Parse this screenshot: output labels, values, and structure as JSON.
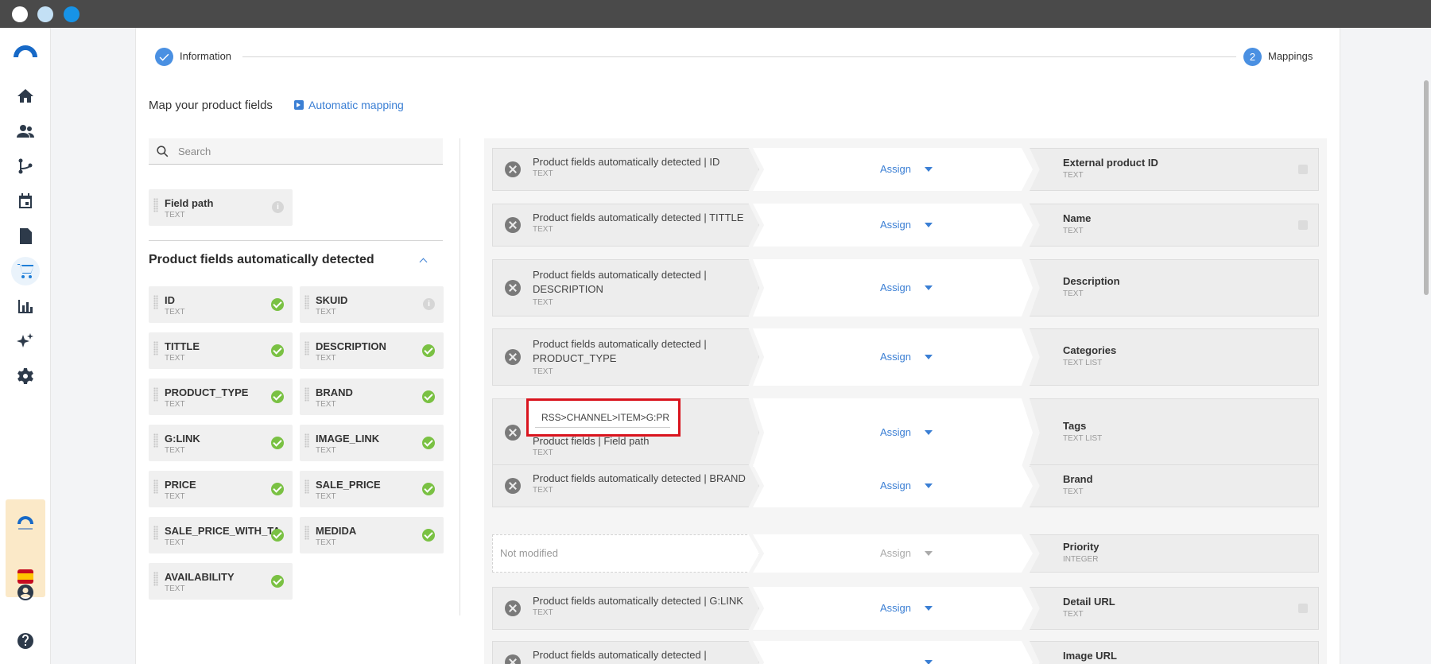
{
  "stepper": {
    "step1_label": "Information",
    "step2_number": "2",
    "step2_label": "Mappings"
  },
  "header": {
    "title": "Map your product fields",
    "auto_mapping": "Automatic mapping"
  },
  "search": {
    "placeholder": "Search"
  },
  "field_path_chip": {
    "name": "Field path",
    "type": "TEXT"
  },
  "section": {
    "title": "Product fields automatically detected"
  },
  "detected_fields": [
    {
      "name": "ID",
      "type": "TEXT",
      "status": "ok"
    },
    {
      "name": "SKUID",
      "type": "TEXT",
      "status": "info"
    },
    {
      "name": "TITTLE",
      "type": "TEXT",
      "status": "ok"
    },
    {
      "name": "DESCRIPTION",
      "type": "TEXT",
      "status": "ok"
    },
    {
      "name": "PRODUCT_TYPE",
      "type": "TEXT",
      "status": "ok"
    },
    {
      "name": "BRAND",
      "type": "TEXT",
      "status": "ok"
    },
    {
      "name": "G:LINK",
      "type": "TEXT",
      "status": "ok"
    },
    {
      "name": "IMAGE_LINK",
      "type": "TEXT",
      "status": "ok"
    },
    {
      "name": "PRICE",
      "type": "TEXT",
      "status": "ok"
    },
    {
      "name": "SALE_PRICE",
      "type": "TEXT",
      "status": "ok"
    },
    {
      "name": "SALE_PRICE_WITH_TAX",
      "type": "TEXT",
      "status": "ok"
    },
    {
      "name": "MEDIDA",
      "type": "TEXT",
      "status": "ok"
    },
    {
      "name": "AVAILABILITY",
      "type": "TEXT",
      "status": "ok"
    }
  ],
  "mappings": [
    {
      "source_line1": "Product fields automatically detected | ID",
      "source_line2": "",
      "source_type": "TEXT",
      "assign": "Assign",
      "target": "External product ID",
      "target_type": "TEXT"
    },
    {
      "source_line1": "Product fields automatically detected | TITTLE",
      "source_line2": "",
      "source_type": "TEXT",
      "assign": "Assign",
      "target": "Name",
      "target_type": "TEXT"
    },
    {
      "source_line1": "Product fields automatically detected |",
      "source_line2": "DESCRIPTION",
      "source_type": "TEXT",
      "assign": "Assign",
      "target": "Description",
      "target_type": "TEXT"
    },
    {
      "source_line1": "Product fields automatically detected |",
      "source_line2": "PRODUCT_TYPE",
      "source_type": "TEXT",
      "assign": "Assign",
      "target": "Categories",
      "target_type": "TEXT LIST"
    },
    {
      "source_line1": "Product fields | Field path",
      "source_line2": "",
      "source_type": "TEXT",
      "path_value": "RSS>CHANNEL>ITEM>G:PR",
      "assign": "Assign",
      "target": "Tags",
      "target_type": "TEXT LIST"
    },
    {
      "source_line1": "Product fields automatically detected | BRAND",
      "source_line2": "",
      "source_type": "TEXT",
      "assign": "Assign",
      "target": "Brand",
      "target_type": "TEXT"
    },
    {
      "source_empty": "Not modified",
      "assign": "Assign",
      "target": "Priority",
      "target_type": "INTEGER"
    },
    {
      "source_line1": "Product fields automatically detected | G:LINK",
      "source_line2": "",
      "source_type": "TEXT",
      "assign": "Assign",
      "target": "Detail URL",
      "target_type": "TEXT"
    },
    {
      "source_line1": "Product fields automatically detected |",
      "source_line2": "",
      "source_type": "",
      "assign": "",
      "target": "Image URL",
      "target_type": ""
    }
  ],
  "colors": {
    "accent": "#4a90e2",
    "link": "#3b7fd4",
    "ok": "#7ac143",
    "highlight_border": "#d9141e"
  }
}
